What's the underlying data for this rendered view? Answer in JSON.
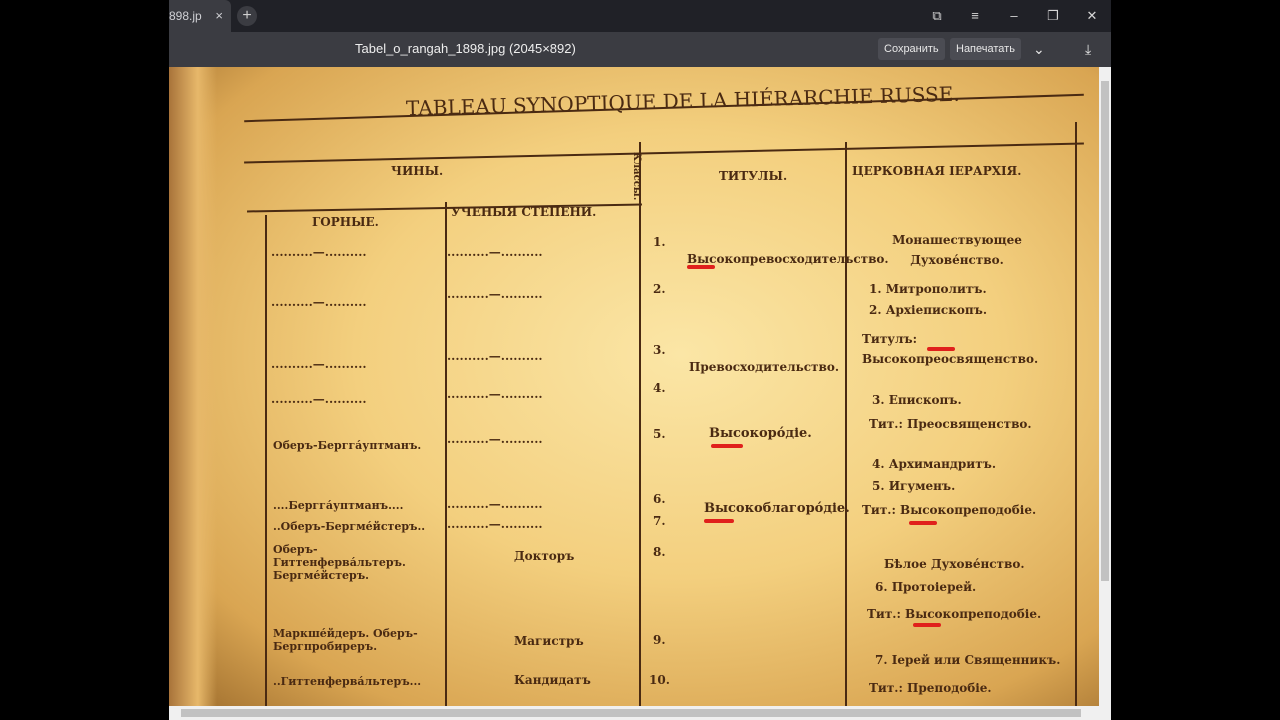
{
  "tab": {
    "title": "898.jp",
    "close": "×"
  },
  "window": {
    "new_tab": "+",
    "bookmark": "⧉",
    "menu": "≡",
    "minimize": "–",
    "restore": "❐",
    "close": "✕"
  },
  "toolbar": {
    "file_title": "Tabel_o_rangah_1898.jpg (2045×892)",
    "save": "Сохранить",
    "print": "Напечатать",
    "more": "⌄",
    "download": "⤓"
  },
  "doc": {
    "title": "TABLEAU SYNOPTIQUE DE LA HIÉRARCHIE RUSSE.",
    "h_chiny": "ЧИНЫ.",
    "h_gornye": "ГОРНЫЕ.",
    "h_uchenye": "УЧЕНЫЯ СТЕПЕНИ.",
    "h_klassy": "Классы.",
    "h_tituly": "ТИТУЛЫ.",
    "h_church": "ЦЕРКОВНАЯ ІЕРАРХІЯ.",
    "gornye": [
      "Оберъ-Бергга́уптманъ.",
      "....Бергга́уптманъ....",
      "..Оберъ-Бергме́йстеръ..",
      "Оберъ-Гиттенферва́льтеръ. Бергме́йстеръ.",
      "Маркше́йдеръ. Оберъ-Бергпробиреръ.",
      "..Гиттенферва́льтеръ..."
    ],
    "uchenye": [
      "Докторъ",
      "Магистръ",
      "Кандидатъ"
    ],
    "classes": [
      "1.",
      "2.",
      "3.",
      "4.",
      "5.",
      "6.",
      "7.",
      "8.",
      "9.",
      "10."
    ],
    "tituly": [
      "Высокопревосходительство.",
      "Превосходительство.",
      "Высокоро́діе.",
      "Высокоблагоро́діе."
    ],
    "church": [
      "Монашествующее Духове́нство.",
      "1. Митрополитъ.",
      "2. Архіепископъ.",
      "Титулъ: Высокопреосвященство.",
      "3. Епископъ.",
      "Тит.: Преосвященство.",
      "4. Архимандритъ.",
      "5. Игуменъ.",
      "Тит.: Высокопреподобіе.",
      "Бѣлое Духове́нство.",
      "6. Протоіерей.",
      "Тит.: Высокопреподобіе.",
      "7. Іерей или Священникъ.",
      "Тит.: Преподобіе."
    ],
    "dots": "..........—.........."
  }
}
